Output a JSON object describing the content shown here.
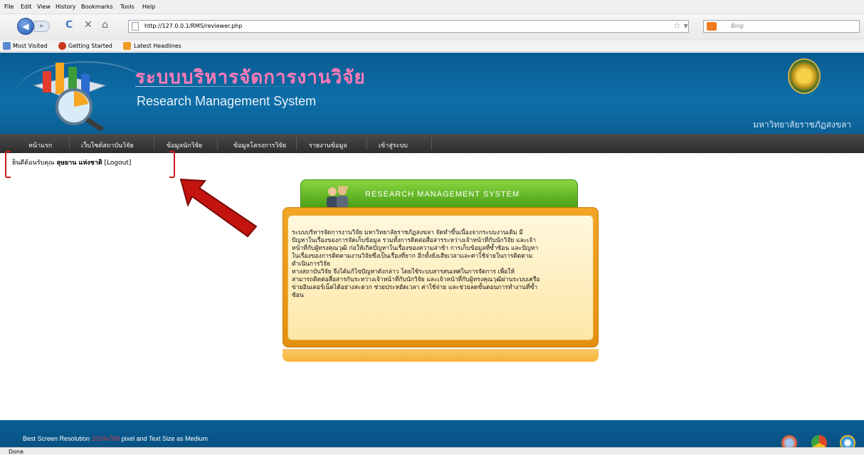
{
  "browser": {
    "menu": [
      "File",
      "Edit",
      "View",
      "History",
      "Bookmarks",
      "Tools",
      "Help"
    ],
    "url": "http://127.0.0.1/RMS/reviewer.php",
    "search_placeholder": "Bing",
    "bookmarks": [
      "Most Visited",
      "Getting Started",
      "Latest Headlines"
    ],
    "status": "Done"
  },
  "header": {
    "title_th": "ระบบบริหารจัดการงานวิจัย",
    "title_en": "Research Management System",
    "university": "มหาวิทยาลัยราชภัฏสงขลา"
  },
  "nav": [
    "หน้าแรก",
    "เว็บไซต์สถาบันวิจัย",
    "ข้อมูลนักวิจัย",
    "ข้อมูลโครงการวิจัย",
    "รายงานข้อมูล",
    "เข้าสู่ระบบ"
  ],
  "welcome": {
    "prefix": "ยินดีต้อนรับคุณ",
    "name": "ลุษยาน แห่งชาติ",
    "logout": "[Logout]"
  },
  "panel": {
    "heading": "RESEARCH MANAGEMENT SYSTEM",
    "body": "        ระบบบริหารจัดการงานวิจัย มหาวิทยาลัยราชภัฏสงขลา จัดทำขึ้นเนื่องจากระบบงานเดิม มี\nปัญหาในเรื่องของการจัดเก็บข้อมูล รวมทั้งการติดต่อสื่อสารระหว่างเจ้าหน้าที่กับนักวิจัย และเจ้า\nหน้าที่กับผู้ทรงคุณวุฒิ ก่อให้เกิดปัญหาในเรื่องของความล่าช้า การเก็บข้อมูลที่ซ้ำซ้อน และปัญหา\nในเรื่องของการติดตามงานวิจัยซึ่งเป็นเรื่องที่ยาก อีกทั้งยังเสียเวลาและค่าใช้จ่ายในการติดตาม\nดำเนินการวิจัย\n        ทางสถาบันวิจัย จึงได้แก้ไขปัญหาดังกล่าว โดยใช้ระบบสารสนเทศในการจัดการ เพื่อให้\nสามารถติดต่อสื่อสารกันระหว่างเจ้าหน้าที่กับนักวิจัย และเจ้าหน้าที่กับผู้ทรงคุณวุฒิผ่านระบบเครือ\nข่ายอินเตอร์เน็ตได้อย่างสะดวก ช่วยประหยัดเวลา ค่าใช้จ่าย และช่วยลดขั้นตอนการทำงานที่ซ้ำ\nซ้อน"
  },
  "footer": {
    "before": "Best Screen Resolution",
    "resolution": "1024x768",
    "after": "pixel and Text Size as Medium"
  },
  "colors": {
    "header_blue": "#0d6ea8",
    "title_pink": "#ff7ab8",
    "panel_orange": "#f3a524",
    "panel_green": "#5fb824",
    "annotation_red": "#cc1a1a"
  }
}
